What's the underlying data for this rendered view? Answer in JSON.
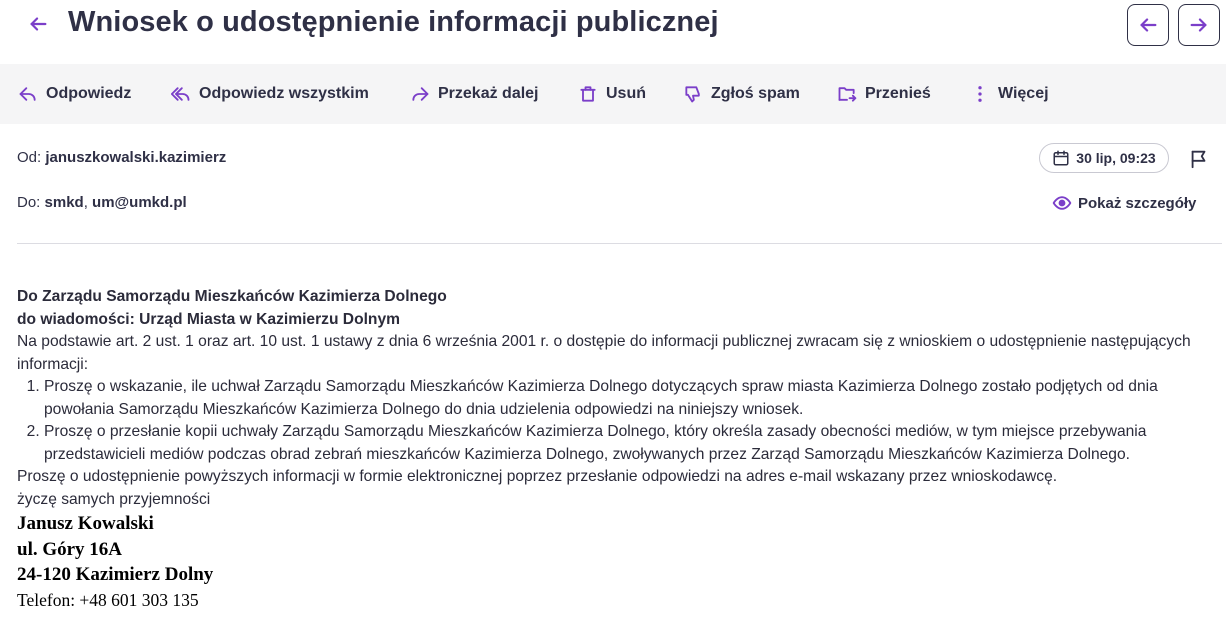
{
  "header": {
    "title": "Wniosek o udostępnienie informacji publicznej",
    "back_icon": "arrow-left-icon",
    "prev_icon": "arrow-left-icon",
    "next_icon": "arrow-right-icon"
  },
  "colors": {
    "accent": "#7b3fc9",
    "text_dark": "#2f3046",
    "toolbar_bg": "#f5f5f6"
  },
  "toolbar": {
    "reply": "Odpowiedz",
    "reply_all": "Odpowiedz wszystkim",
    "forward": "Przekaż dalej",
    "delete": "Usuń",
    "spam": "Zgłoś spam",
    "move": "Przenieś",
    "more": "Więcej"
  },
  "meta": {
    "from_label": "Od:",
    "from_value": "januszkowalski.kazimierz",
    "to_label": "Do:",
    "to_values": [
      "smkd",
      "um@umkd.pl"
    ],
    "to_separator": ",",
    "date": "30 lip, 09:23",
    "show_details": "Pokaż szczegóły"
  },
  "message": {
    "recipient_line1": "Do Zarządu Samorządu Mieszkańców Kazimierza Dolnego",
    "recipient_line2": "do wiadomości: Urząd Miasta w Kazimierzu Dolnym",
    "intro": "Na podstawie art. 2 ust. 1 oraz art. 10 ust. 1 ustawy z dnia 6 września 2001 r. o dostępie do informacji publicznej zwracam się z wnioskiem o udostępnienie następujących informacji:",
    "items": [
      "Proszę o wskazanie, ile uchwał Zarządu Samorządu Mieszkańców Kazimierza Dolnego dotyczących spraw miasta Kazimierza Dolnego zostało podjętych od dnia powołania Samorządu Mieszkańców Kazimierza Dolnego do dnia udzielenia odpowiedzi na niniejszy wniosek.",
      "Proszę o przesłanie kopii uchwały Zarządu Samorządu Mieszkańców Kazimierza Dolnego, który określa zasady obecności mediów, w tym miejsce przebywania przedstawicieli mediów podczas obrad zebrań mieszkańców Kazimierza Dolnego, zwoływanych przez Zarząd Samorządu Mieszkańców Kazimierza Dolnego."
    ],
    "request": "Proszę o udostępnienie powyższych informacji w formie elektronicznej poprzez przesłanie odpowiedzi na adres e-mail wskazany przez wnioskodawcę.",
    "closing": "życzę samych przyjemności",
    "signature": {
      "name": "Janusz Kowalski",
      "street": "ul. Góry 16A",
      "city": "24-120 Kazimierz Dolny",
      "phone": "Telefon: +48 601 303 135"
    }
  }
}
